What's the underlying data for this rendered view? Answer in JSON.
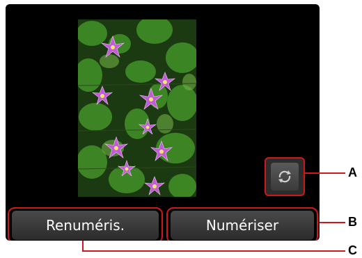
{
  "buttons": {
    "rescan_label": "Renuméris.",
    "scan_label": "Numériser"
  },
  "rotate": {
    "icon": "rotate-icon"
  },
  "callouts": {
    "a": "A",
    "b": "B",
    "c": "C"
  },
  "colors": {
    "callout": "#d01818",
    "screen": "#000000"
  }
}
